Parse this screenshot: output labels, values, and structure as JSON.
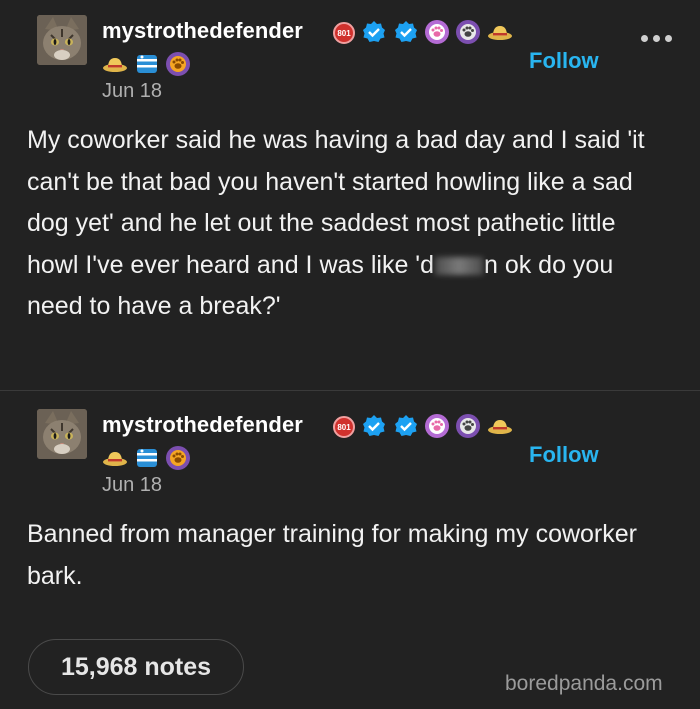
{
  "posts": [
    {
      "username": "mystrothedefender",
      "date": "Jun 18",
      "follow_label": "Follow",
      "badge_text": "801",
      "badges": [
        "badge-801-icon",
        "verified-check-icon",
        "verified-check-icon",
        "pink-paw-icon",
        "purple-paw-icon",
        "straw-hat-icon",
        "straw-hat-icon",
        "striped-fish-icon",
        "orange-paw-icon"
      ],
      "text_before": "My coworker said he was having a bad day and I said 'it can't be that bad you haven't started howling like a sad dog yet' and he let out the saddest most pathetic little howl I've ever heard and I was like 'd",
      "text_after": "n ok do you need to have a break?'"
    },
    {
      "username": "mystrothedefender",
      "date": "Jun 18",
      "follow_label": "Follow",
      "badge_text": "801",
      "text": "Banned from manager training for making my coworker bark."
    }
  ],
  "notes_label": "15,968 notes",
  "watermark": "boredpanda.com",
  "colors": {
    "background": "#222222",
    "follow": "#29b5f0",
    "verified": "#1da1f2",
    "badge_red": "#d0312d",
    "text": "#f2f2f2",
    "muted": "#b0b0b0"
  }
}
